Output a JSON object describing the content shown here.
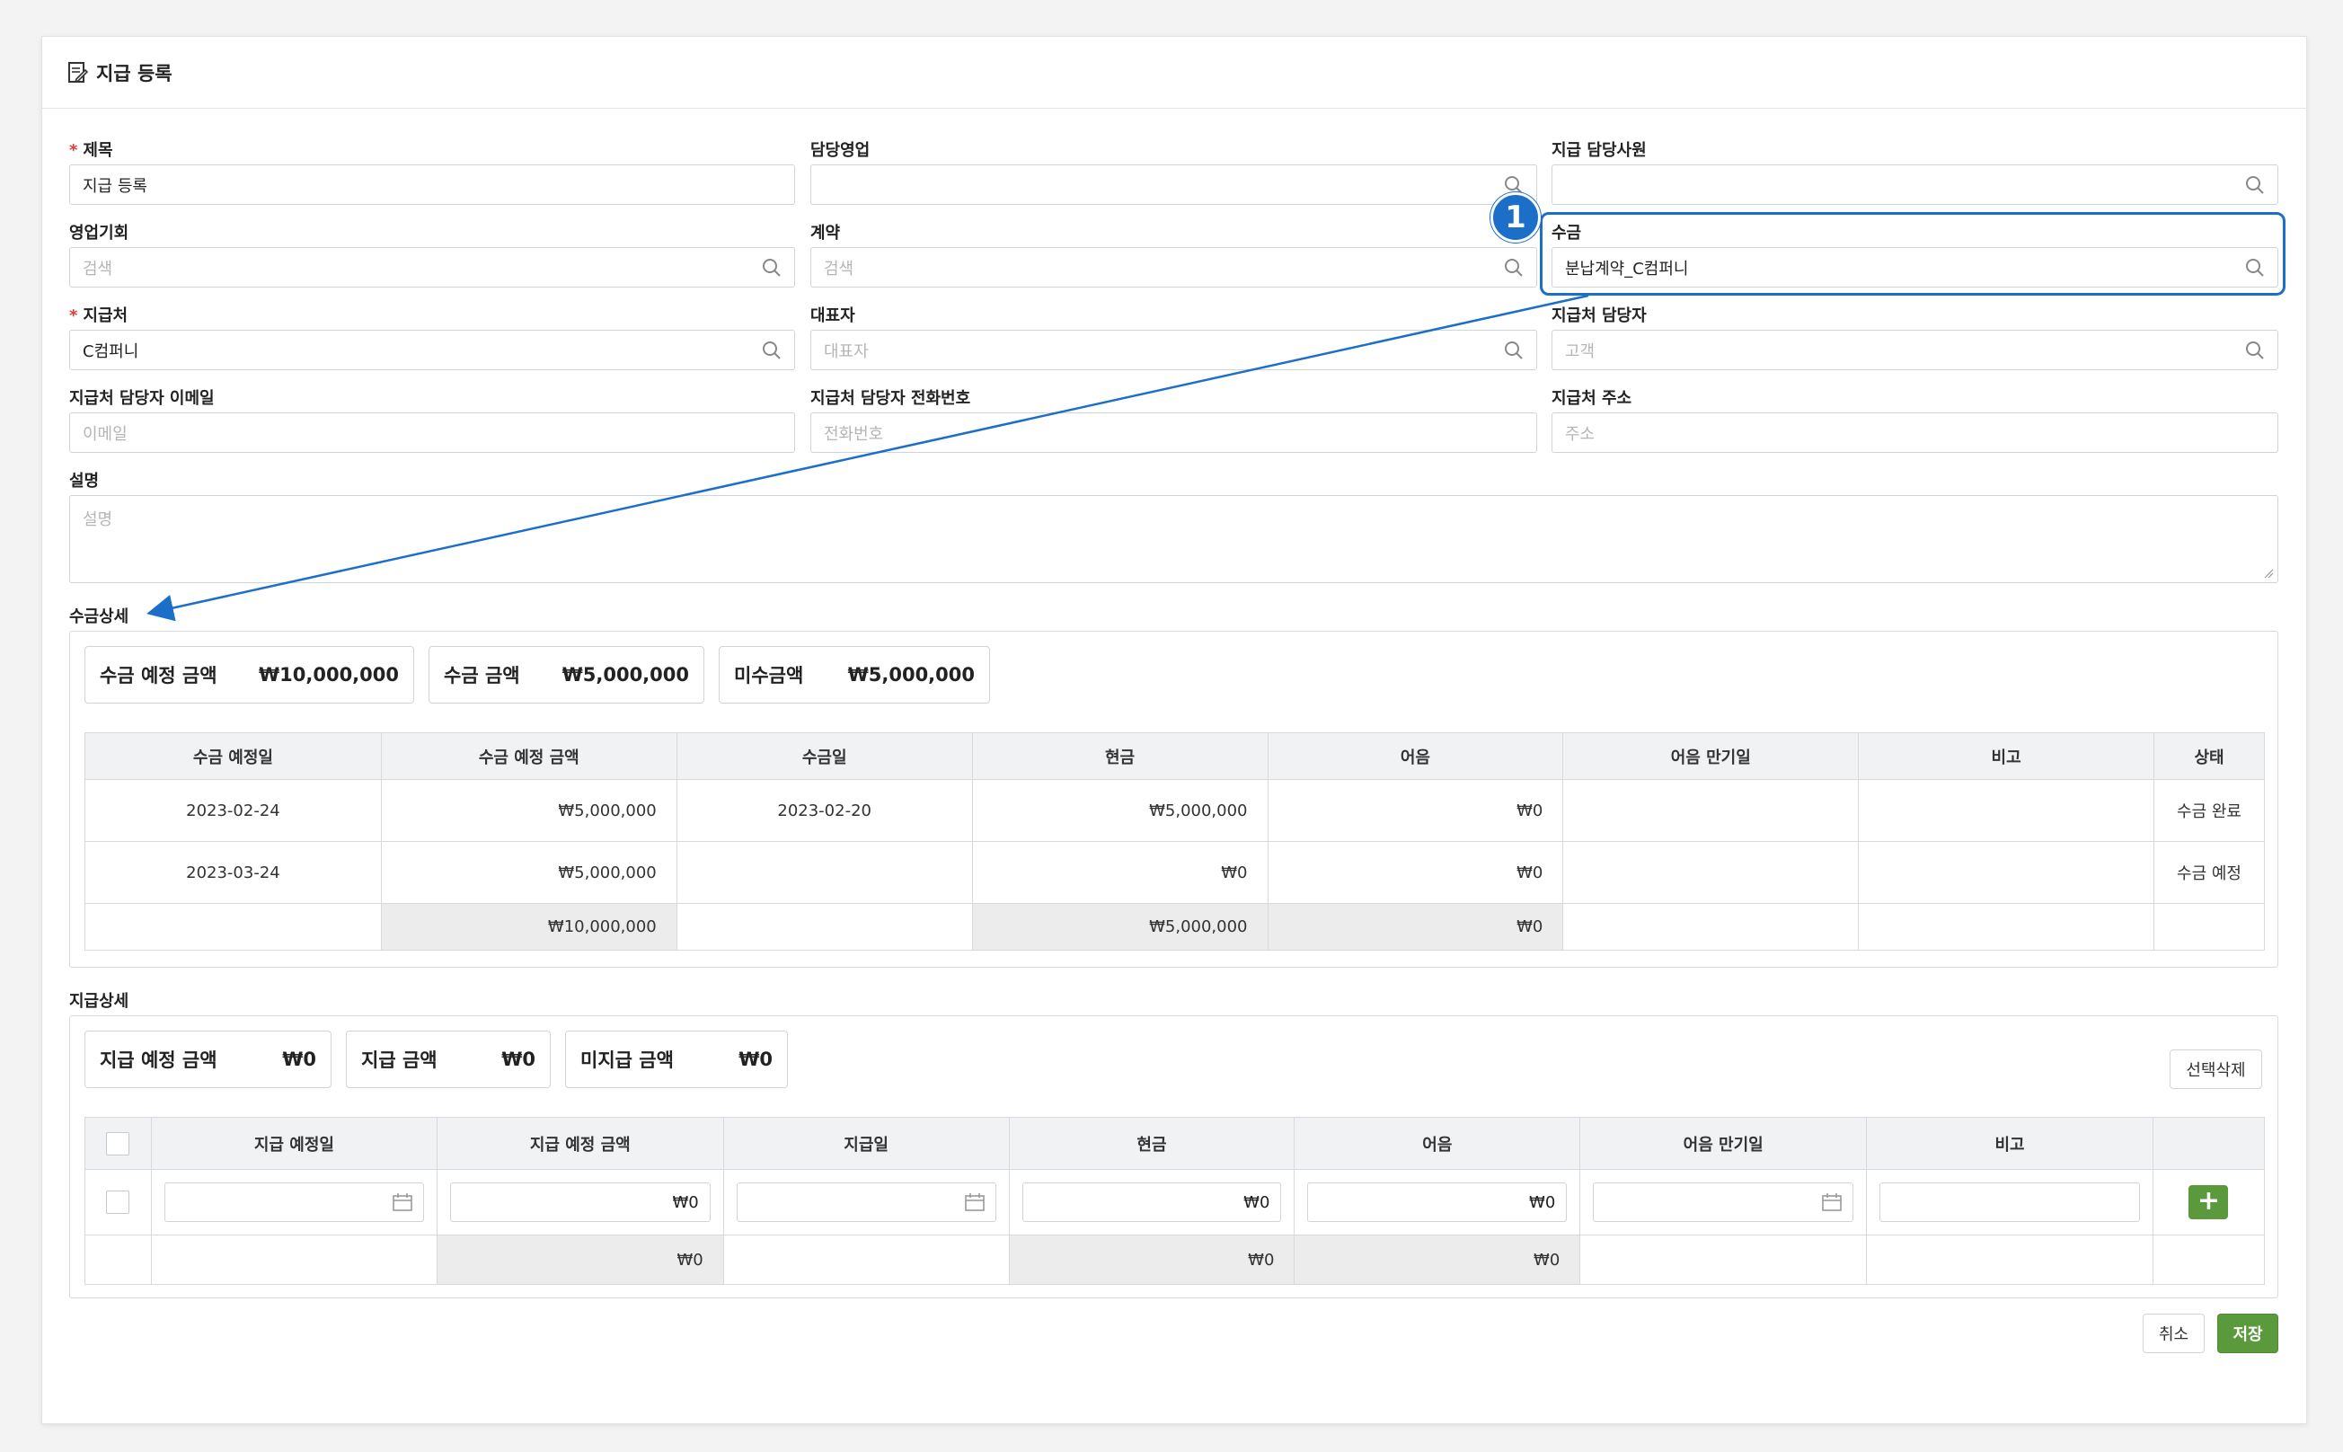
{
  "header": {
    "title": "지급 등록",
    "icon": "document-edit-icon"
  },
  "form": {
    "title": {
      "label": "제목",
      "value": "지급 등록",
      "required": true
    },
    "sales_rep": {
      "label": "담당영업",
      "value": ""
    },
    "pay_staff": {
      "label": "지급 담당사원",
      "value": ""
    },
    "opportunity": {
      "label": "영업기회",
      "placeholder": "검색"
    },
    "contract": {
      "label": "계약",
      "placeholder": "검색"
    },
    "receipt": {
      "label": "수금",
      "value": "분납계약_C컴퍼니"
    },
    "payee": {
      "label": "지급처",
      "value": "C컴퍼니",
      "required": true
    },
    "representative": {
      "label": "대표자",
      "placeholder": "대표자"
    },
    "payee_contact": {
      "label": "지급처 담당자",
      "placeholder": "고객"
    },
    "payee_email": {
      "label": "지급처 담당자 이메일",
      "placeholder": "이메일"
    },
    "payee_phone": {
      "label": "지급처 담당자 전화번호",
      "placeholder": "전화번호"
    },
    "payee_address": {
      "label": "지급처 주소",
      "placeholder": "주소"
    },
    "description": {
      "label": "설명",
      "placeholder": "설명"
    }
  },
  "receipt_detail": {
    "title": "수금상세",
    "summary": [
      {
        "label": "수금 예정 금액",
        "value": "₩10,000,000"
      },
      {
        "label": "수금 금액",
        "value": "₩5,000,000"
      },
      {
        "label": "미수금액",
        "value": "₩5,000,000"
      }
    ],
    "columns": [
      "수금 예정일",
      "수금 예정 금액",
      "수금일",
      "현금",
      "어음",
      "어음 만기일",
      "비고",
      "상태"
    ],
    "rows": [
      [
        "2023-02-24",
        "₩5,000,000",
        "2023-02-20",
        "₩5,000,000",
        "₩0",
        "",
        "",
        "수금 완료"
      ],
      [
        "2023-03-24",
        "₩5,000,000",
        "",
        "₩0",
        "₩0",
        "",
        "",
        "수금 예정"
      ]
    ],
    "totals": [
      "",
      "₩10,000,000",
      "",
      "₩5,000,000",
      "₩0",
      "",
      "",
      ""
    ]
  },
  "payment_detail": {
    "title": "지급상세",
    "summary": [
      {
        "label": "지급 예정 금액",
        "value": "₩0"
      },
      {
        "label": "지급 금액",
        "value": "₩0"
      },
      {
        "label": "미지급 금액",
        "value": "₩0"
      }
    ],
    "delete_label": "선택삭제",
    "columns": [
      "지급 예정일",
      "지급 예정 금액",
      "지급일",
      "현금",
      "어음",
      "어음 만기일",
      "비고"
    ],
    "input_row": {
      "amount": "₩0",
      "cash": "₩0",
      "note_amount": "₩0"
    },
    "totals": {
      "amount": "₩0",
      "cash": "₩0",
      "note": "₩0"
    }
  },
  "footer": {
    "cancel_label": "취소",
    "save_label": "저장"
  },
  "annotation": {
    "badge": "1",
    "accent": "#1b6fc9"
  },
  "colors": {
    "primary_green": "#5a9a3c",
    "required_red": "#e03b3b"
  }
}
